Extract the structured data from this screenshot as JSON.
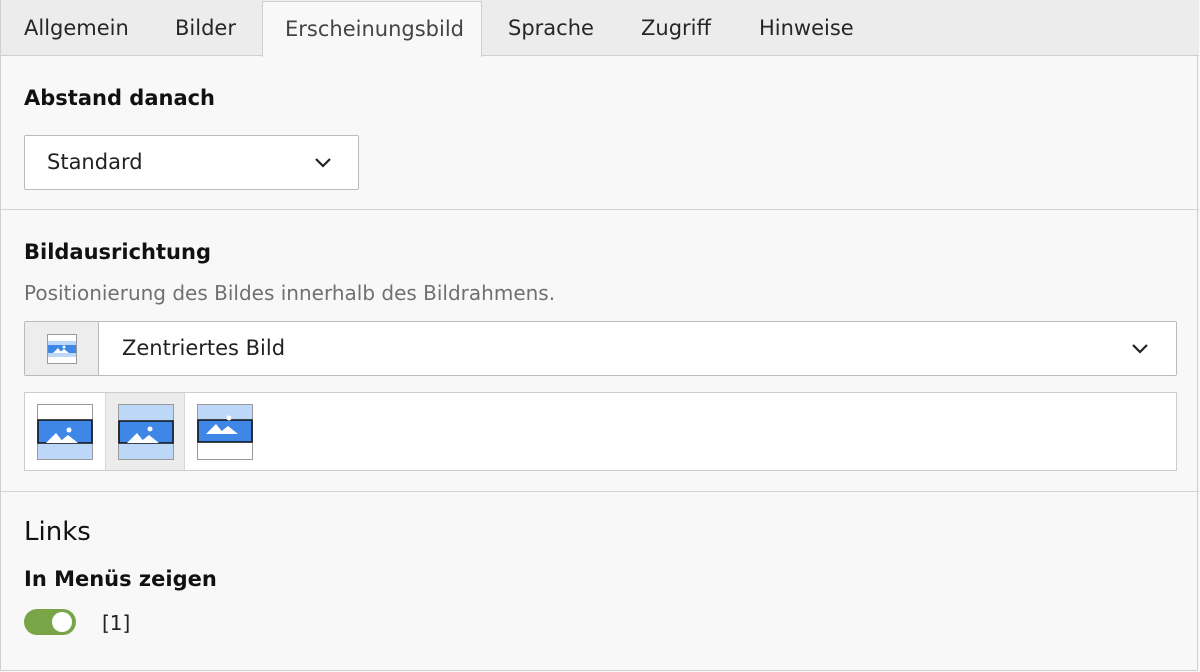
{
  "tabs": [
    {
      "label": "Allgemein"
    },
    {
      "label": "Bilder"
    },
    {
      "label": "Erscheinungsbild",
      "active": true
    },
    {
      "label": "Sprache"
    },
    {
      "label": "Zugriff"
    },
    {
      "label": "Hinweise"
    }
  ],
  "spacing_after": {
    "label": "Abstand danach",
    "selected": "Standard"
  },
  "image_alignment": {
    "label": "Bildausrichtung",
    "description": "Positionierung des Bildes innerhalb des Bildrahmens.",
    "selected": "Zentriertes Bild",
    "options_icons": [
      "image-bottom-icon",
      "image-center-icon",
      "image-top-icon"
    ],
    "selected_index": 1
  },
  "links": {
    "heading": "Links",
    "show_in_menus_label": "In Menüs zeigen",
    "toggle_value_label": "[1]",
    "toggle_on": true
  },
  "colors": {
    "accent_blue": "#3f87e6",
    "light_blue": "#bcd7f7",
    "toggle_green": "#79a548"
  }
}
